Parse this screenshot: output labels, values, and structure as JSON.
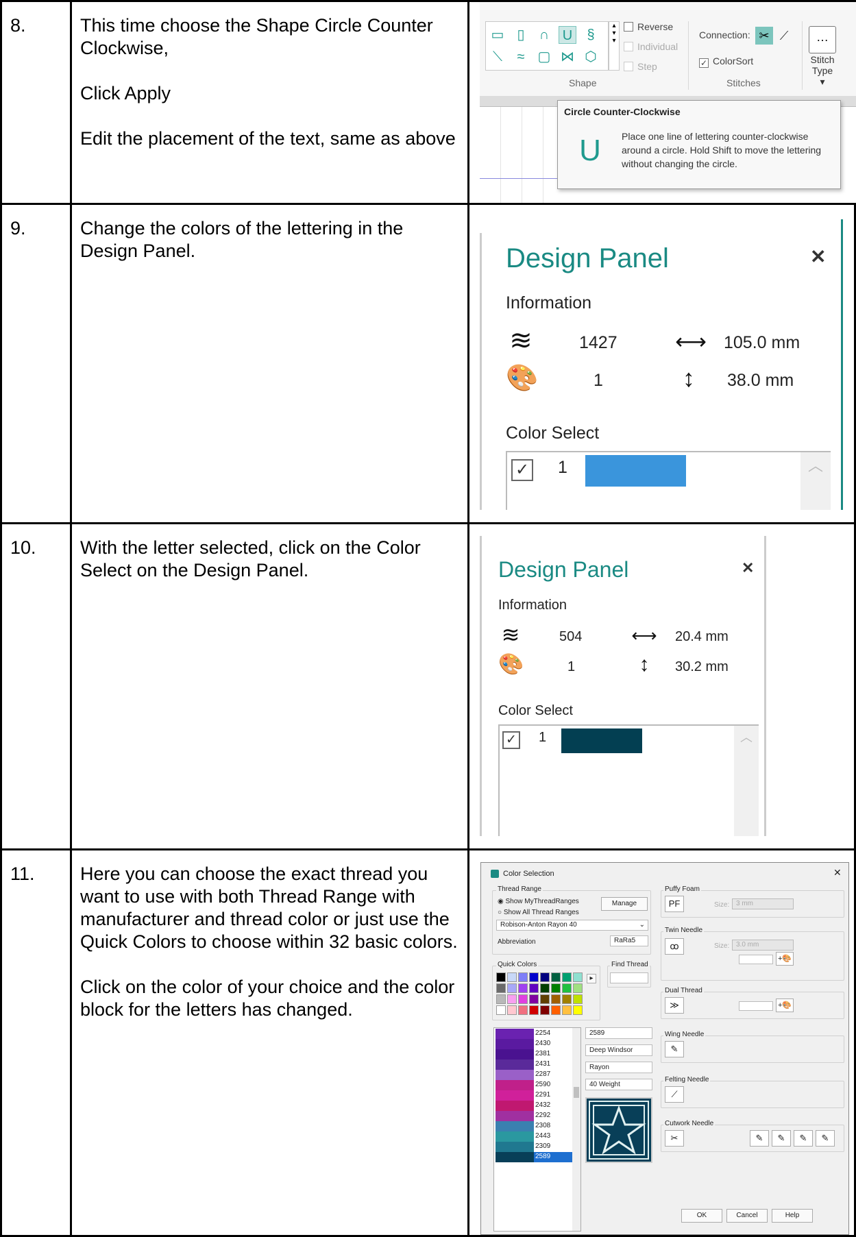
{
  "rows": [
    {
      "num": "8.",
      "paras": [
        "This time choose the Shape Circle Counter Clockwise,",
        "Click Apply",
        "Edit the placement of the text, same as above"
      ]
    },
    {
      "num": "9.",
      "paras": [
        "Change the colors of the lettering in the Design Panel."
      ]
    },
    {
      "num": "10.",
      "paras": [
        "With the letter selected, click on the Color Select on the Design Panel."
      ]
    },
    {
      "num": "11.",
      "paras": [
        "Here you can choose the exact thread you want to use with both Thread Range with manufacturer and thread color or just use the Quick Colors to choose within 32 basic colors.",
        "Click on the color of your choice and the color block for the letters has changed."
      ]
    }
  ],
  "ribbon": {
    "reverse": "Reverse",
    "individual": "Individual",
    "step": "Step",
    "shape_group": "Shape",
    "connection": "Connection:",
    "colorsort": "ColorSort",
    "stitches_group": "Stitches",
    "stitch_type_1": "Stitch",
    "stitch_type_2": "Type ▾"
  },
  "tooltip": {
    "title": "Circle Counter-Clockwise",
    "desc": "Place one line of lettering counter-clockwise around a circle. Hold Shift to move the lettering without changing the circle."
  },
  "panel_a": {
    "title": "Design Panel",
    "information": "Information",
    "stitches": "1427",
    "width": "105.0 mm",
    "colors": "1",
    "height": "38.0 mm",
    "color_select": "Color Select",
    "swatch_num": "1",
    "swatch_color": "#3a95dc"
  },
  "panel_b": {
    "title": "Design Panel",
    "information": "Information",
    "stitches": "504",
    "width": "20.4 mm",
    "colors": "1",
    "height": "30.2 mm",
    "color_select": "Color Select",
    "swatch_num": "1",
    "swatch_color": "#033f52"
  },
  "dialog": {
    "title": "Color Selection",
    "thread_range": "Thread Range",
    "show_my": "Show MyThreadRanges",
    "show_all": "Show All Thread Ranges",
    "manage": "Manage",
    "range_value": "Robison-Anton Rayon 40",
    "abbreviation": "Abbreviation",
    "abbr_value": "RaRa5",
    "quick_colors": "Quick Colors",
    "find_thread": "Find Thread",
    "quick_palette": [
      "#000000",
      "#c8d8f8",
      "#7f7ff8",
      "#0000cc",
      "#00007f",
      "#006040",
      "#00a070",
      "#8fe0d0",
      "#6a6a6a",
      "#a8a8f8",
      "#a040f0",
      "#6000c0",
      "#004000",
      "#008000",
      "#20c040",
      "#a0e080",
      "#b8b8b8",
      "#f8a0f0",
      "#e040e0",
      "#8000a0",
      "#604000",
      "#a06000",
      "#a08000",
      "#c0e000",
      "#ffffff",
      "#ffc8d0",
      "#f07080",
      "#d00000",
      "#800000",
      "#ff6000",
      "#ffc040",
      "#ffff00"
    ],
    "threads": [
      {
        "code": "2254",
        "color": "#6a22b0"
      },
      {
        "code": "2430",
        "color": "#5a1aa0"
      },
      {
        "code": "2381",
        "color": "#4a1290"
      },
      {
        "code": "2431",
        "color": "#5a2a9a"
      },
      {
        "code": "2287",
        "color": "#9a60c8"
      },
      {
        "code": "2590",
        "color": "#c0208a"
      },
      {
        "code": "2291",
        "color": "#d0209a"
      },
      {
        "code": "2432",
        "color": "#c01870"
      },
      {
        "code": "2292",
        "color": "#a030a0"
      },
      {
        "code": "2308",
        "color": "#3a80b0"
      },
      {
        "code": "2443",
        "color": "#2a98a0"
      },
      {
        "code": "2309",
        "color": "#207890"
      },
      {
        "code": "2589",
        "color": "#083f58"
      }
    ],
    "selected_thread": "2589",
    "detail_code": "2589",
    "detail_name": "Deep Windsor",
    "detail_type": "Rayon",
    "detail_weight": "40 Weight",
    "puffy_foam": "Puffy Foam",
    "size_label": "Size:",
    "puffy_size": "3 mm",
    "twin_needle": "Twin Needle",
    "twin_size": "3.0 mm",
    "dual_thread": "Dual Thread",
    "wing_needle": "Wing Needle",
    "felting_needle": "Felting Needle",
    "cutwork_needle": "Cutwork Needle",
    "ok": "OK",
    "cancel": "Cancel",
    "help": "Help",
    "close": "✕"
  }
}
